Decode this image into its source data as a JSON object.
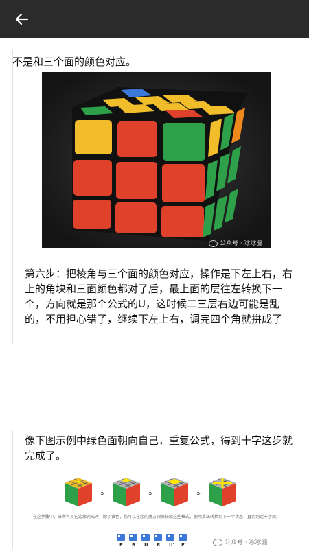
{
  "header": {
    "back_icon": "arrow-left-icon"
  },
  "article": {
    "text1": "不是和三个面的颜色对应。",
    "image1_watermark": "公众号 · 冰冰骊",
    "text2": "第六步：把棱角与三个面的颜色对应，操作是下左上右，右上的角块和三面颜色都对了后，最上面的层往左转换下一个，方向就是那个公式的U，这时候二三层右边可能是乱的，不用担心错了，继续下左上右，调完四个角就拼成了",
    "text3": "像下图示例中绿色面朝向自己，重复公式，得到十字这步就完成了。",
    "image2_caption": "在这步骤中，当所有其它边缘完成时，除了黄色，您可以在您的魔方顶部获取这些模式。使用算法转换到下一个状态，直到到达十字架。",
    "image2_watermark": "公众号 · 冰冰骊",
    "move_labels": [
      "F",
      "R",
      "U",
      "R'",
      "U'",
      "F'"
    ]
  },
  "colors": {
    "topbar": "#2b2b2b",
    "cube_bg": "#222222",
    "red": "#e0412b",
    "green": "#2fa04a",
    "yellow": "#f2bd2a",
    "orange": "#f08a1c",
    "blue": "#3b78d8"
  }
}
